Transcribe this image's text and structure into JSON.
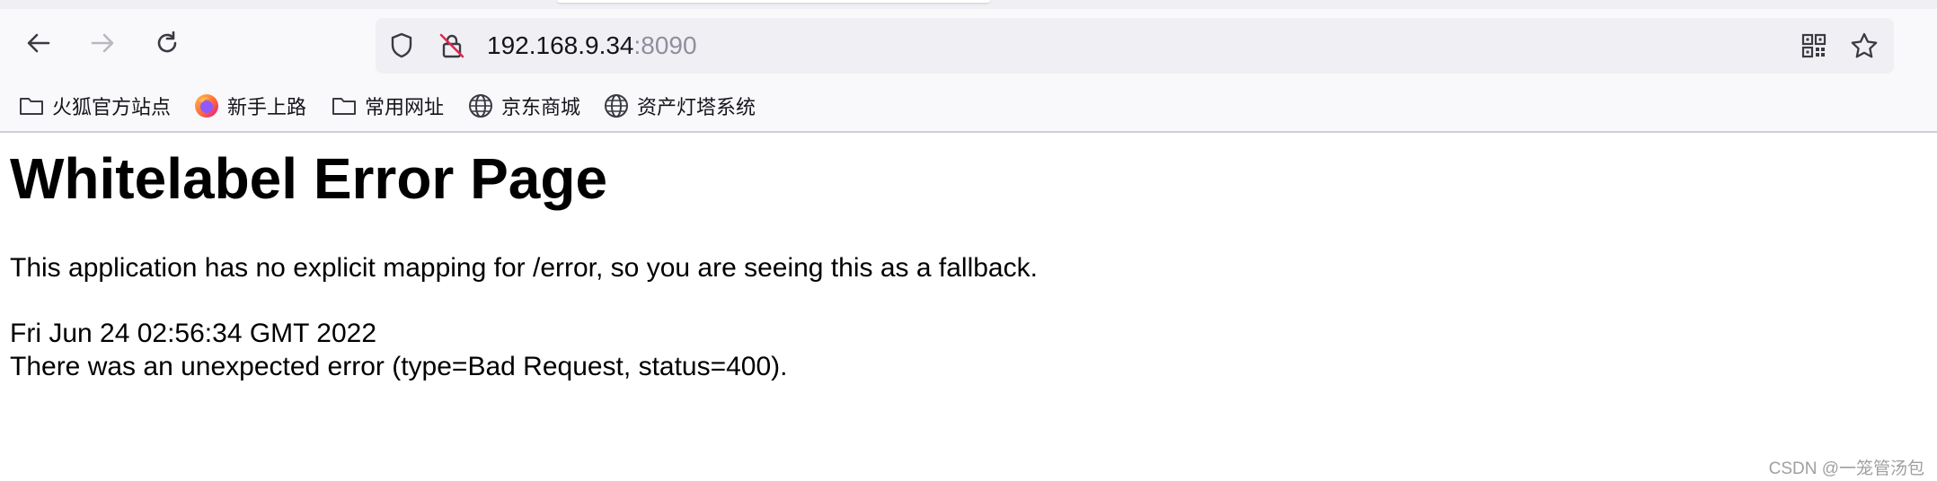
{
  "browser": {
    "navigation": {
      "back_icon": "arrow-left-icon",
      "forward_icon": "arrow-right-icon",
      "reload_icon": "reload-icon"
    },
    "urlbar": {
      "host": "192.168.9.34",
      "port": ":8090",
      "security_icon": "shield-icon",
      "insecure_icon": "insecure-lock-icon",
      "qr_icon": "qr-code-icon",
      "bookmark_star_icon": "star-icon"
    },
    "bookmarks": [
      {
        "label": "火狐官方站点",
        "icon": "folder-icon"
      },
      {
        "label": "新手上路",
        "icon": "firefox-icon"
      },
      {
        "label": "常用网址",
        "icon": "folder-icon"
      },
      {
        "label": "京东商城",
        "icon": "globe-icon"
      },
      {
        "label": "资产灯塔系统",
        "icon": "globe-icon"
      }
    ]
  },
  "page": {
    "title": "Whitelabel Error Page",
    "fallback_message": "This application has no explicit mapping for /error, so you are seeing this as a fallback.",
    "timestamp": "Fri Jun 24 02:56:34 GMT 2022",
    "error_detail": "There was an unexpected error (type=Bad Request, status=400)."
  },
  "watermark": "CSDN @一笼管汤包",
  "colors": {
    "toolbar_bg": "#f9f9fb",
    "urlbar_bg": "#f0f0f4",
    "text": "#15141a",
    "port_text": "#8f8f9d",
    "icon": "#5b5b66",
    "insecure_strike": "#e22850",
    "firefox_orange": "#ff7139",
    "firefox_purple": "#9059ff"
  }
}
